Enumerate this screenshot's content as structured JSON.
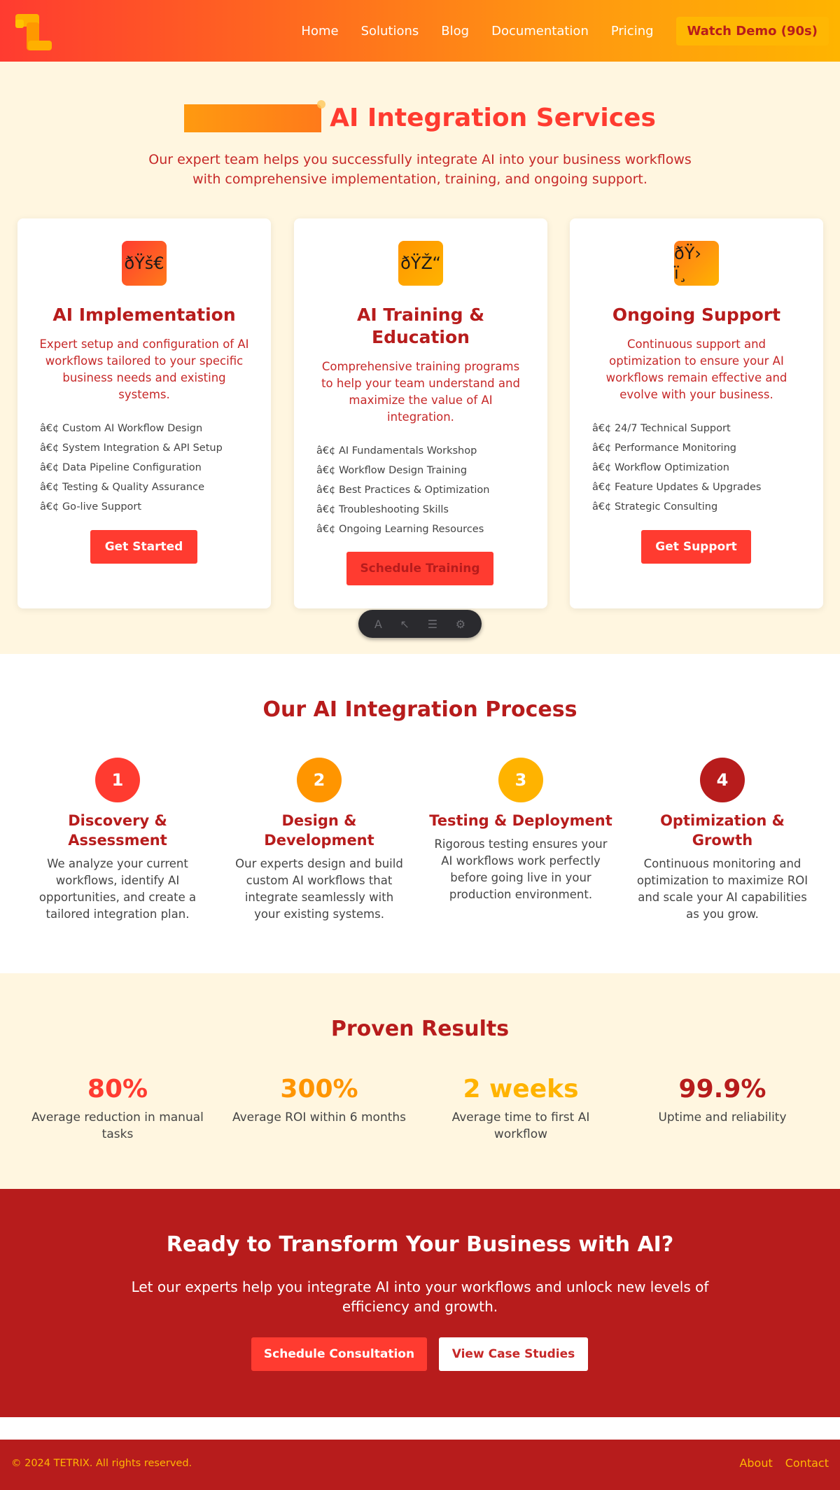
{
  "nav": {
    "links": [
      "Home",
      "Solutions",
      "Blog",
      "Documentation",
      "Pricing"
    ],
    "cta": "Watch Demo (90s)",
    "logo_icon": "tetrix-logo-icon"
  },
  "hero": {
    "title": "AI Integration Services",
    "subtitle": "Our expert team helps you successfully integrate AI into your business workflows with comprehensive implementation, training, and ongoing support."
  },
  "services": [
    {
      "icon": "ðŸš€",
      "title": "AI Implementation",
      "description": "Expert setup and configuration of AI workflows tailored to your specific business needs and existing systems.",
      "features": [
        "â€¢ Custom AI Workflow Design",
        "â€¢ System Integration & API Setup",
        "â€¢ Data Pipeline Configuration",
        "â€¢ Testing & Quality Assurance",
        "â€¢ Go-live Support"
      ],
      "button": "Get Started"
    },
    {
      "icon": "ðŸŽ“",
      "title": "AI Training & Education",
      "description": "Comprehensive training programs to help your team understand and maximize the value of AI integration.",
      "features": [
        "â€¢ AI Fundamentals Workshop",
        "â€¢ Workflow Design Training",
        "â€¢ Best Practices & Optimization",
        "â€¢ Troubleshooting Skills",
        "â€¢ Ongoing Learning Resources"
      ],
      "button": "Schedule Training"
    },
    {
      "icon": "ðŸ› ï¸",
      "title": "Ongoing Support",
      "description": "Continuous support and optimization to ensure your AI workflows remain effective and evolve with your business.",
      "features": [
        "â€¢ 24/7 Technical Support",
        "â€¢ Performance Monitoring",
        "â€¢ Workflow Optimization",
        "â€¢ Feature Updates & Upgrades",
        "â€¢ Strategic Consulting"
      ],
      "button": "Get Support"
    }
  ],
  "process": {
    "title": "Our AI Integration Process",
    "steps": [
      {
        "num": "1",
        "title": "Discovery & Assessment",
        "desc": "We analyze your current workflows, identify AI opportunities, and create a tailored integration plan.",
        "color": "#ff3b30"
      },
      {
        "num": "2",
        "title": "Design & Development",
        "desc": "Our experts design and build custom AI workflows that integrate seamlessly with your existing systems.",
        "color": "#ff9500"
      },
      {
        "num": "3",
        "title": "Testing & Deployment",
        "desc": "Rigorous testing ensures your AI workflows work perfectly before going live in your production environment.",
        "color": "#ffb300"
      },
      {
        "num": "4",
        "title": "Optimization & Growth",
        "desc": "Continuous monitoring and optimization to maximize ROI and scale your AI capabilities as you grow.",
        "color": "#b71c1c"
      }
    ]
  },
  "results": {
    "title": "Proven Results",
    "stats": [
      {
        "value": "80%",
        "label": "Average reduction in manual tasks",
        "color": "#ff3b30"
      },
      {
        "value": "300%",
        "label": "Average ROI within 6 months",
        "color": "#ff9500"
      },
      {
        "value": "2 weeks",
        "label": "Average time to first AI workflow",
        "color": "#ffb300"
      },
      {
        "value": "99.9%",
        "label": "Uptime and reliability",
        "color": "#b71c1c"
      }
    ]
  },
  "cta": {
    "title": "Ready to Transform Your Business with AI?",
    "subtitle": "Let our experts help you integrate AI into your workflows and unlock new levels of efficiency and growth.",
    "primary": "Schedule Consultation",
    "secondary": "View Case Studies"
  },
  "footer": {
    "copyright": "© 2024 TETRIX. All rights reserved.",
    "links": [
      "About",
      "Contact"
    ]
  },
  "toolbar": {
    "icons": [
      "text-icon",
      "cursor-icon",
      "inspect-icon",
      "settings-icon"
    ]
  },
  "colors": {
    "primary": "#ff3b30",
    "dark_red": "#b71c1c",
    "amber": "#ffb703",
    "cream": "#fff6e0"
  }
}
